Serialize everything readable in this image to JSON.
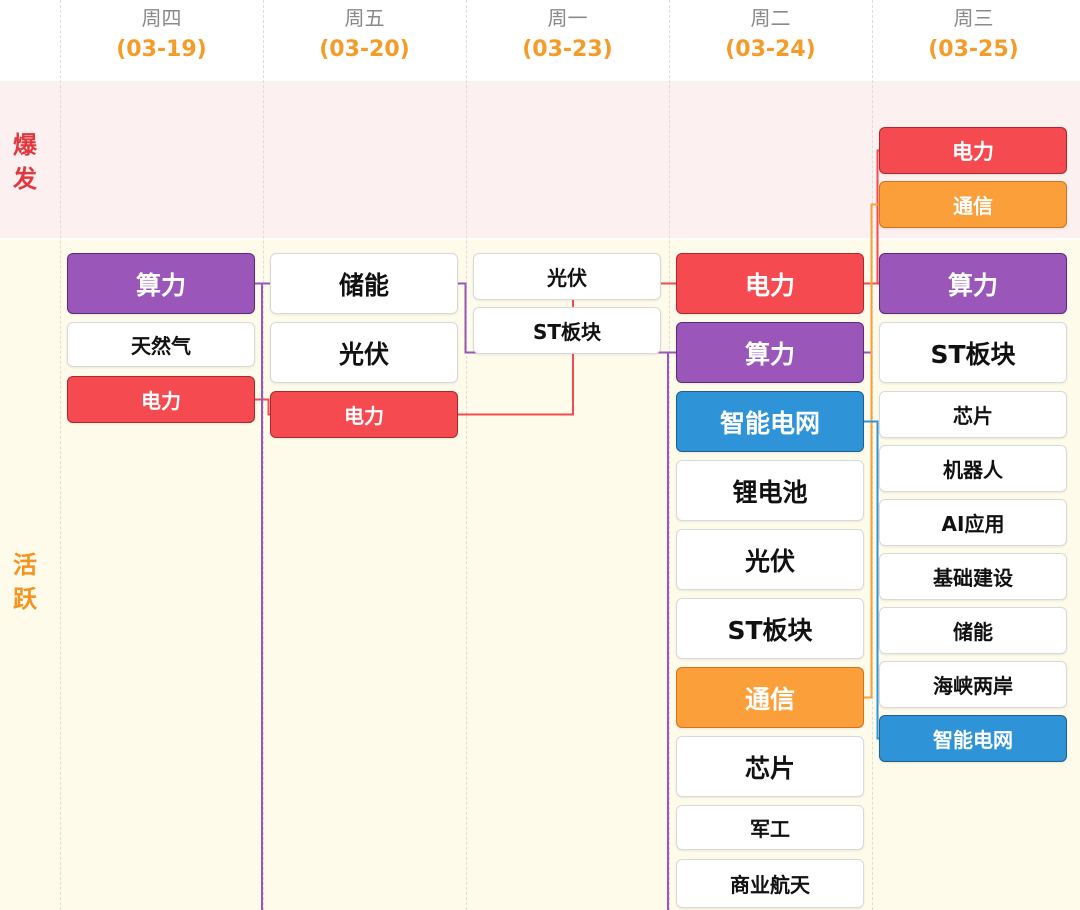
{
  "days": [
    {
      "weekday": "周四",
      "date": "(03-19)"
    },
    {
      "weekday": "周五",
      "date": "(03-20)"
    },
    {
      "weekday": "周一",
      "date": "(03-23)"
    },
    {
      "weekday": "周二",
      "date": "(03-24)"
    },
    {
      "weekday": "周三",
      "date": "(03-25)"
    }
  ],
  "zones": {
    "burst": {
      "chars": [
        "爆",
        "发"
      ],
      "color": "#e0383e"
    },
    "active": {
      "chars": [
        "活",
        "跃"
      ],
      "color": "#f5931e"
    }
  },
  "chart_data": {
    "type": "table",
    "columns": [
      "周四 (03-19)",
      "周五 (03-20)",
      "周一 (03-23)",
      "周二 (03-24)",
      "周三 (03-25)"
    ],
    "rows": [
      "爆发",
      "活跃"
    ],
    "cells": {
      "爆发": [
        [],
        [],
        [],
        [],
        [
          "电力",
          "通信"
        ]
      ],
      "活跃": [
        [
          "算力",
          "天然气",
          "电力"
        ],
        [
          "储能",
          "光伏",
          "电力"
        ],
        [
          "光伏",
          "ST板块"
        ],
        [
          "电力",
          "算力",
          "智能电网",
          "锂电池",
          "光伏",
          "ST板块",
          "通信",
          "芯片",
          "军工",
          "商业航天"
        ],
        [
          "算力",
          "ST板块",
          "芯片",
          "机器人",
          "AI应用",
          "基础建设",
          "储能",
          "海峡两岸",
          "智能电网"
        ]
      ]
    },
    "highlight_colors": {
      "算力": "#9a56b8",
      "电力": "#f54a4f",
      "通信": "#fb9f3b",
      "智能电网": "#2f93d8"
    },
    "links": [
      {
        "sector": "算力",
        "color": "#9a56b8"
      },
      {
        "sector": "电力",
        "color": "#f54a4f"
      },
      {
        "sector": "通信",
        "color": "#fb9f3b"
      },
      {
        "sector": "智能电网",
        "color": "#2f93d8"
      }
    ]
  }
}
